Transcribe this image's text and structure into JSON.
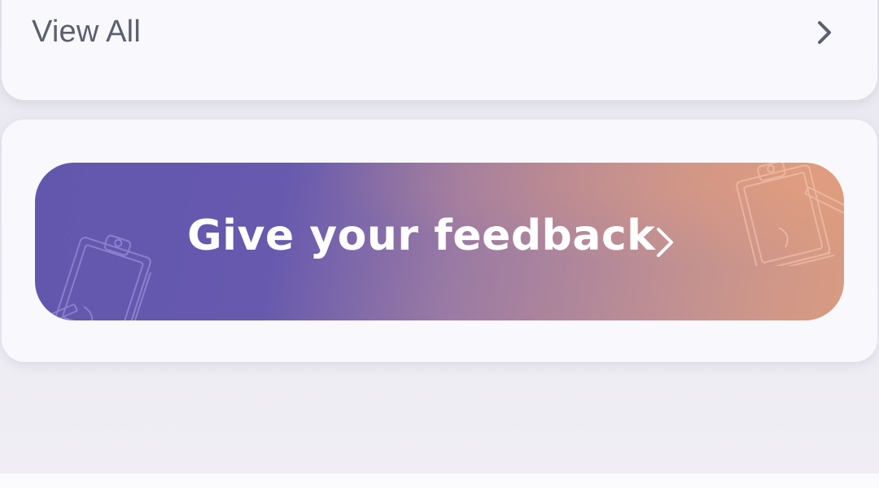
{
  "view_all": {
    "label": "View All",
    "icon": "chevron-right-icon"
  },
  "feedback_banner": {
    "label": "Give your feedback",
    "icon": "chevron-right-icon",
    "decorations": [
      "clipboard-icon",
      "clipboard-icon"
    ],
    "gradient_start": "#6257ad",
    "gradient_end": "#d89a82"
  },
  "colors": {
    "background": "#ecebf2",
    "card": "#f9f8fc",
    "text_secondary": "#5b6070",
    "banner_text": "#ffffff"
  }
}
